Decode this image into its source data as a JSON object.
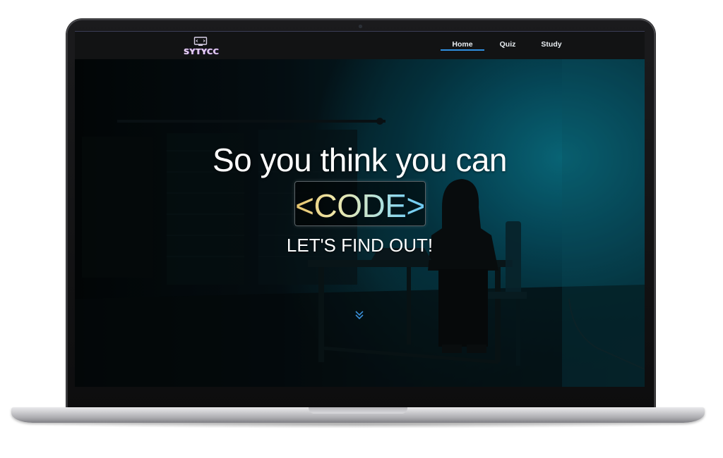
{
  "navbar": {
    "logo_text": "SYTYCC",
    "items": [
      {
        "label": "Home",
        "active": true
      },
      {
        "label": "Quiz",
        "active": false
      },
      {
        "label": "Study",
        "active": false
      }
    ],
    "accent_color": "#2f8fe0"
  },
  "hero": {
    "headline": "So you think you can",
    "code_word": "<CODE>",
    "subheadline": "LET'S FIND OUT!",
    "scroll_icon": "chevron-double-down-icon"
  },
  "colors": {
    "navbar_bg": "#121314",
    "hero_teal": "#0a7a8f",
    "text": "#ffffff"
  }
}
